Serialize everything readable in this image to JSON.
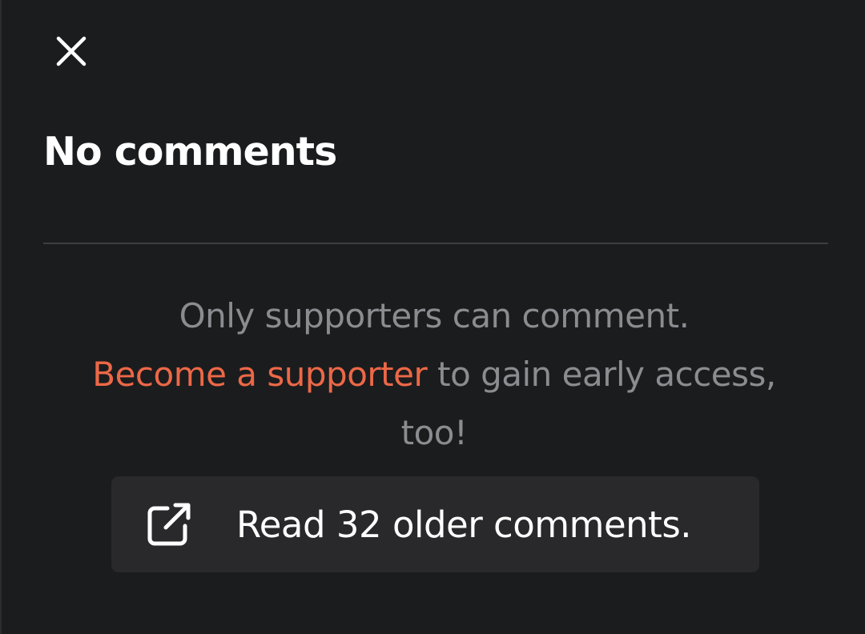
{
  "panel": {
    "close_icon": "close-icon",
    "title": "No comments",
    "message": {
      "line1": "Only supporters can comment.",
      "link_text": "Become a supporter",
      "rest": " to gain early access, too!",
      "link_color": "#ec6847"
    },
    "older_comments_button": {
      "icon": "external-link-icon",
      "label": "Read 32 older comments."
    }
  },
  "colors": {
    "background": "#1b1c1e",
    "button_background": "#29292c",
    "muted_text": "#8b8c90",
    "accent": "#ec6847",
    "divider": "#3c3d41"
  }
}
